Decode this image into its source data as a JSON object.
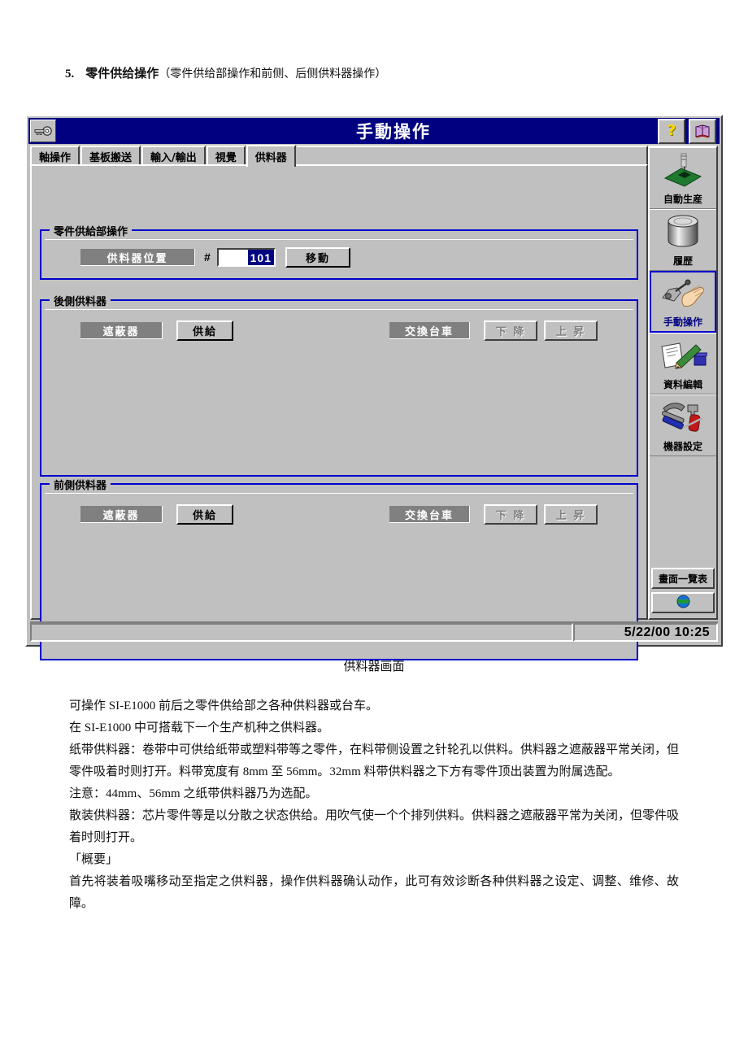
{
  "document": {
    "heading_number": "5.",
    "heading_title": "零件供给操作",
    "heading_subtitle": "（零件供给部操作和前侧、后侧供料器操作）",
    "figure_caption": "供料器画面",
    "paragraphs": [
      "可操作 SI-E1000 前后之零件供给部之各种供料器或台车。",
      "在 SI-E1000 中可搭载下一个生产机种之供料器。",
      "纸带供料器：卷带中可供给纸带或塑料带等之零件，在料带侧设置之针轮孔以供料。供料器之遮蔽器平常关闭，但零件吸着时则打开。料带宽度有 8mm 至 56mm。32mm 料带供料器之下方有零件顶出装置为附属选配。",
      "注意：44mm、56mm 之纸带供料器乃为选配。",
      "散装供料器：芯片零件等是以分散之状态供给。用吹气使一个个排列供料。供料器之遮蔽器平常为关闭，但零件吸着时则打开。",
      "「概要」",
      "首先将装着吸嘴移动至指定之供料器，操作供料器确认动作，此可有效诊断各种供料器之设定、调整、维修、故障。"
    ]
  },
  "window": {
    "title": "手動操作",
    "system_icon": "key-icon",
    "title_buttons": [
      {
        "name": "help-button",
        "glyph": "?"
      },
      {
        "name": "manual-book-button",
        "glyph": "◆"
      }
    ],
    "tabs": [
      {
        "label": "軸操作",
        "active": false
      },
      {
        "label": "基板搬送",
        "active": false
      },
      {
        "label": "輸入/輸出",
        "active": false
      },
      {
        "label": "視覺",
        "active": false
      },
      {
        "label": "供料器",
        "active": true
      }
    ]
  },
  "groups": {
    "supply": {
      "legend": "零件供給部操作",
      "position_tag": "供料器位置",
      "hash": "#",
      "field_value": "101",
      "move_button": "移動"
    },
    "rear": {
      "legend": "後側供料器",
      "shutter_tag": "遮蔽器",
      "supply_button": "供給",
      "cart_tag": "交換台車",
      "down_button": "下 降",
      "up_button": "上 昇"
    },
    "front": {
      "legend": "前側供料器",
      "shutter_tag": "遮蔽器",
      "supply_button": "供給",
      "cart_tag": "交換台車",
      "down_button": "下 降",
      "up_button": "上 昇"
    }
  },
  "sidebar": {
    "items": [
      {
        "label": "自動生産",
        "icon": "pcb-insert-icon",
        "selected": false
      },
      {
        "label": "履歴",
        "icon": "database-cylinder-icon",
        "selected": false
      },
      {
        "label": "手動操作",
        "icon": "hand-manual-icon",
        "selected": true
      },
      {
        "label": "資料編輯",
        "icon": "pencil-document-icon",
        "selected": false
      },
      {
        "label": "機器設定",
        "icon": "tools-hammer-screwdriver-icon",
        "selected": false
      }
    ],
    "screen_list_button": "畫面一覽表",
    "globe_button_icon": "globe-icon"
  },
  "statusbar": {
    "message": "",
    "datetime": "5/22/00 10:25"
  },
  "colors": {
    "titlebar": "#000080",
    "face": "#c0c0c0",
    "group_border": "#0000cd",
    "tag_gray": "#808080",
    "selection": "#000080"
  }
}
